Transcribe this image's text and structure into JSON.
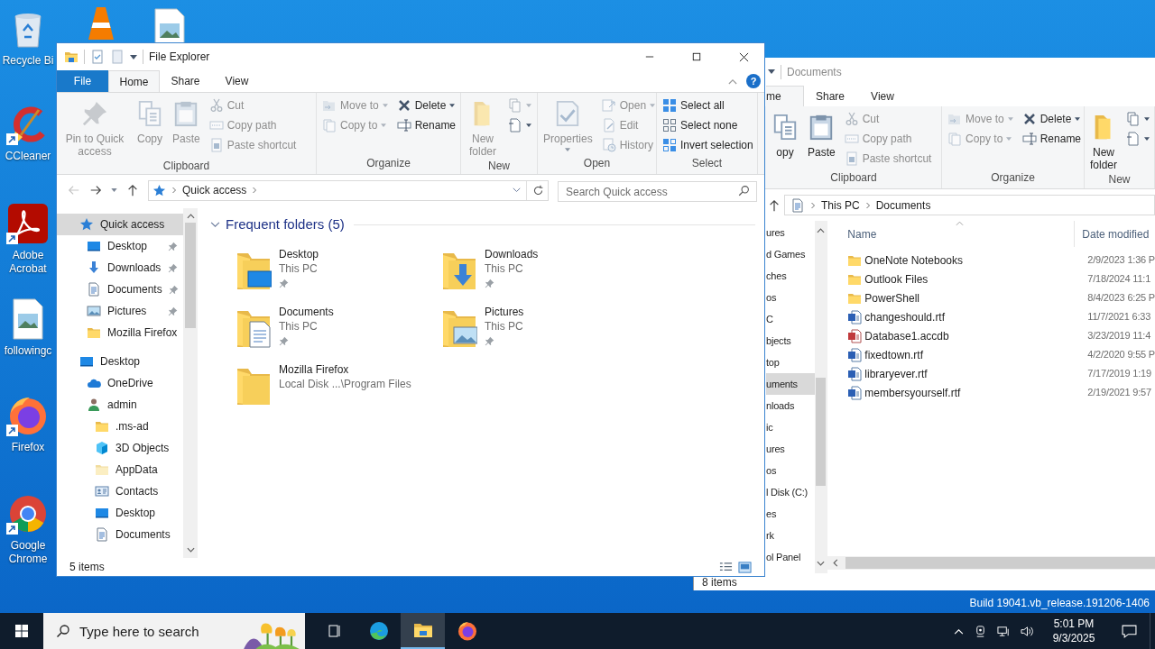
{
  "desktop_icons": [
    {
      "kind": "recycle_bin",
      "label": "Recycle Bi",
      "shortcut": false
    },
    {
      "kind": "cone",
      "shortcut": false
    },
    {
      "kind": "image_file",
      "shortcut": false
    },
    {
      "kind": "cleaner",
      "label": "CCleaner",
      "shortcut": true
    },
    {
      "kind": "acrobat",
      "label": "Adobe Acrobat",
      "shortcut": true
    },
    {
      "kind": "image_file",
      "label": "followingc",
      "shortcut": false
    },
    {
      "kind": "firefox",
      "label": "Firefox",
      "shortcut": true
    },
    {
      "kind": "chrome",
      "label": "Google Chrome",
      "shortcut": true
    }
  ],
  "front_window": {
    "title": "File Explorer",
    "help": "?",
    "tabs": [
      {
        "label": "File",
        "kind": "file",
        "selected": false
      },
      {
        "label": "Home",
        "kind": "tab",
        "selected": true
      },
      {
        "label": "Share",
        "kind": "tab",
        "selected": false
      },
      {
        "label": "View",
        "kind": "tab",
        "selected": false
      }
    ],
    "ribbon": [
      {
        "label": "Clipboard",
        "columns": [
          {
            "kind": "large",
            "items": [
              {
                "label": "Pin to Quick access",
                "disabled": true
              }
            ]
          },
          {
            "kind": "large",
            "items": [
              {
                "label": "Copy",
                "disabled": true
              }
            ]
          },
          {
            "kind": "large",
            "items": [
              {
                "label": "Paste",
                "disabled": true
              }
            ]
          },
          {
            "kind": "small",
            "items": [
              {
                "label": "Cut",
                "disabled": true
              },
              {
                "label": "Copy path",
                "disabled": true
              },
              {
                "label": "Paste shortcut",
                "disabled": true
              }
            ]
          }
        ]
      },
      {
        "label": "Organize",
        "columns": [
          {
            "kind": "small",
            "items": [
              {
                "label": "Move to",
                "disabled": true,
                "dropdown": true
              },
              {
                "label": "Copy to",
                "disabled": true,
                "dropdown": true
              }
            ]
          },
          {
            "kind": "small",
            "items": [
              {
                "label": "Delete",
                "disabled": false,
                "dropdown": true
              },
              {
                "label": "Rename",
                "disabled": false
              }
            ]
          }
        ]
      },
      {
        "label": "New",
        "columns": [
          {
            "kind": "large",
            "items": [
              {
                "label": "New folder",
                "disabled": true
              }
            ]
          },
          {
            "kind": "small",
            "items": [
              {
                "disabled": true,
                "dropdown": true
              },
              {
                "disabled": false,
                "dropdown": true
              }
            ]
          }
        ]
      },
      {
        "label": "Open",
        "columns": [
          {
            "kind": "large",
            "items": [
              {
                "label": "Properties",
                "disabled": true,
                "dropdown": true
              }
            ]
          },
          {
            "kind": "small",
            "items": [
              {
                "label": "Open",
                "disabled": true,
                "dropdown": true
              },
              {
                "label": "Edit",
                "disabled": true
              },
              {
                "label": "History",
                "disabled": true
              }
            ]
          }
        ]
      },
      {
        "label": "Select",
        "columns": [
          {
            "kind": "small",
            "items": [
              {
                "label": "Select all",
                "disabled": false
              },
              {
                "label": "Select none",
                "disabled": false
              },
              {
                "label": "Invert selection",
                "disabled": false
              }
            ]
          }
        ]
      }
    ],
    "address": [
      "Quick access"
    ],
    "search_placeholder": "Search Quick access",
    "nav": [
      {
        "label": "Quick access",
        "selected": true,
        "children": [
          {
            "label": "Desktop",
            "pinned": true,
            "selected": false
          },
          {
            "label": "Downloads",
            "pinned": true,
            "selected": false
          },
          {
            "label": "Documents",
            "pinned": true,
            "selected": false
          },
          {
            "label": "Pictures",
            "pinned": true,
            "selected": false
          },
          {
            "label": "Mozilla Firefox",
            "pinned": false,
            "selected": false
          }
        ]
      },
      {
        "label": "Desktop",
        "selected": false,
        "children": [
          {
            "label": "OneDrive",
            "selected": false
          },
          {
            "label": "admin",
            "selected": false,
            "children": [
              {
                "label": ".ms-ad",
                "selected": false
              },
              {
                "label": "3D Objects",
                "selected": false
              },
              {
                "label": "AppData",
                "selected": false
              },
              {
                "label": "Contacts",
                "selected": false
              },
              {
                "label": "Desktop",
                "selected": false
              },
              {
                "label": "Documents",
                "selected": false
              }
            ]
          }
        ]
      }
    ],
    "section": "Frequent folders (5)",
    "folders": [
      {
        "name": "Desktop",
        "location": "This PC",
        "pinned": true
      },
      {
        "name": "Downloads",
        "location": "This PC",
        "pinned": true
      },
      {
        "name": "Documents",
        "location": "This PC",
        "pinned": true
      },
      {
        "name": "Pictures",
        "location": "This PC",
        "pinned": true
      },
      {
        "name": "Mozilla Firefox",
        "location": "Local Disk ...\\Program Files",
        "pinned": false
      }
    ],
    "status": "5 items"
  },
  "back_window": {
    "title": "Documents",
    "tabs": [
      {
        "label": "me",
        "selected": true
      },
      {
        "label": "Share",
        "selected": false
      },
      {
        "label": "View",
        "selected": false
      }
    ],
    "ribbon": [
      {
        "label": "Clipboard",
        "columns": [
          {
            "kind": "large",
            "items": [
              {
                "label": "opy",
                "disabled": false
              }
            ]
          },
          {
            "kind": "large",
            "items": [
              {
                "label": "Paste",
                "disabled": false
              }
            ]
          },
          {
            "kind": "small",
            "items": [
              {
                "label": "Cut",
                "disabled": true
              },
              {
                "label": "Copy path",
                "disabled": true
              },
              {
                "label": "Paste shortcut",
                "disabled": true
              }
            ]
          }
        ]
      },
      {
        "label": "Organize",
        "columns": [
          {
            "kind": "small",
            "items": [
              {
                "label": "Move to",
                "disabled": true,
                "dropdown": true
              },
              {
                "label": "Copy to",
                "disabled": true,
                "dropdown": true
              }
            ]
          },
          {
            "kind": "small",
            "items": [
              {
                "label": "Delete",
                "disabled": false,
                "dropdown": true
              },
              {
                "label": "Rename",
                "disabled": false
              }
            ]
          }
        ]
      },
      {
        "label": "New",
        "columns": [
          {
            "kind": "large",
            "items": [
              {
                "label": "New folder",
                "disabled": false
              }
            ]
          },
          {
            "kind": "small",
            "items": [
              {
                "disabled": false,
                "dropdown": true
              },
              {
                "disabled": false,
                "dropdown": true
              }
            ]
          }
        ]
      }
    ],
    "address": [
      "This PC",
      "Documents"
    ],
    "nav": [
      {
        "label": "ures",
        "selected": false
      },
      {
        "label": "d Games",
        "selected": false
      },
      {
        "label": "ches",
        "selected": false
      },
      {
        "label": "os",
        "selected": false
      },
      {
        "label": "C",
        "selected": false
      },
      {
        "label": "bjects",
        "selected": false
      },
      {
        "label": "top",
        "selected": false
      },
      {
        "label": "uments",
        "selected": true
      },
      {
        "label": "nloads",
        "selected": false
      },
      {
        "label": "ic",
        "selected": false
      },
      {
        "label": "ures",
        "selected": false
      },
      {
        "label": "os",
        "selected": false
      },
      {
        "label": "l Disk (C:)",
        "selected": false
      },
      {
        "label": "es",
        "selected": false
      },
      {
        "label": "rk",
        "selected": false
      },
      {
        "label": "ol Panel",
        "selected": false
      }
    ],
    "columns": [
      "Name",
      "Date modified"
    ],
    "rows": [
      {
        "name": "OneNote Notebooks",
        "kind": "folder",
        "date": "2/9/2023 1:36 P"
      },
      {
        "name": "Outlook Files",
        "kind": "folder",
        "date": "7/18/2024 11:1"
      },
      {
        "name": "PowerShell",
        "kind": "folder",
        "date": "8/4/2023 6:25 P"
      },
      {
        "name": "changeshould.rtf",
        "kind": "document",
        "date": "11/7/2021 6:33"
      },
      {
        "name": "Database1.accdb",
        "kind": "database",
        "date": "3/23/2019 11:4"
      },
      {
        "name": "fixedtown.rtf",
        "kind": "document",
        "date": "4/2/2020 9:55 P"
      },
      {
        "name": "libraryever.rtf",
        "kind": "document",
        "date": "7/17/2019 1:19"
      },
      {
        "name": "membersyourself.rtf",
        "kind": "document",
        "date": "2/19/2021 9:57"
      }
    ],
    "status": "8 items"
  },
  "build_text": "Build 19041.vb_release.191206-1406",
  "taskbar": {
    "search_placeholder": "Type here to search",
    "apps": [
      {
        "kind": "task_view",
        "active": false
      },
      {
        "kind": "edge",
        "active": false
      },
      {
        "kind": "explorer",
        "active": true
      },
      {
        "kind": "firefox",
        "active": false
      }
    ],
    "time": "5:01 PM",
    "date": "9/3/2025"
  }
}
